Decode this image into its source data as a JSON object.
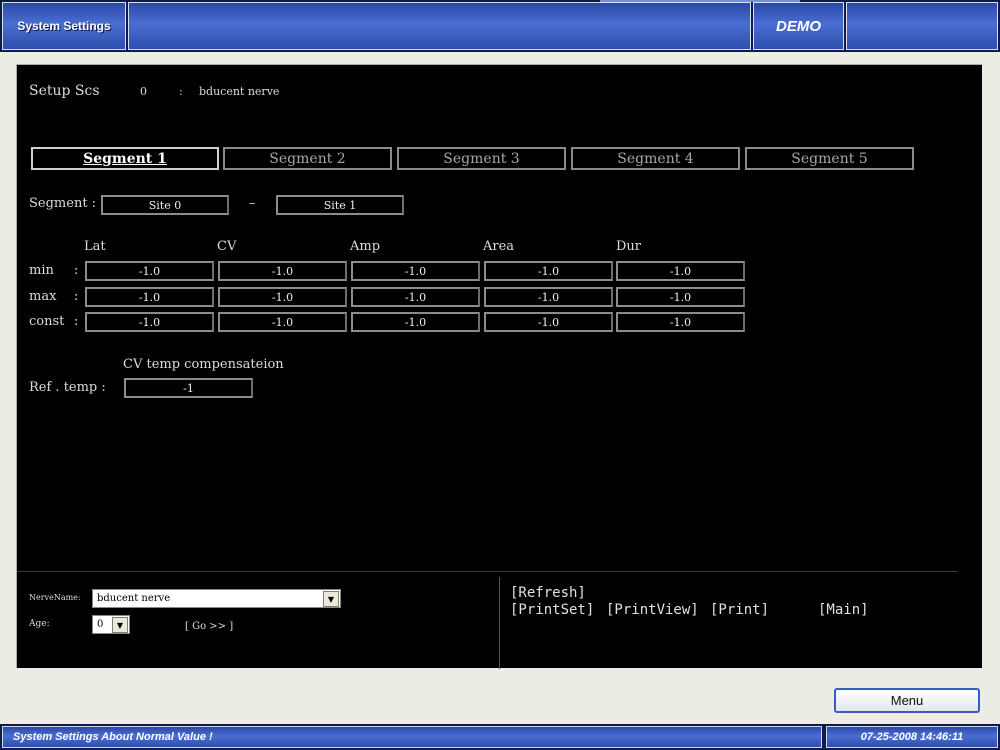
{
  "header": {
    "title": "System Settings",
    "badge": "DEMO"
  },
  "setup": {
    "label": "Setup Scs",
    "number": "0",
    "separator": ":",
    "nerve": "bducent nerve"
  },
  "segment_tabs": [
    "Segment 1",
    "Segment 2",
    "Segment 3",
    "Segment 4",
    "Segment 5"
  ],
  "segment_row": {
    "label": "Segment :",
    "site_from": "Site 0",
    "dash": "–",
    "site_to": "Site 1"
  },
  "grid": {
    "columns": [
      "Lat",
      "CV",
      "Amp",
      "Area",
      "Dur"
    ],
    "rows": [
      {
        "label": "min",
        "colon": ":",
        "values": [
          "-1.0",
          "-1.0",
          "-1.0",
          "-1.0",
          "-1.0"
        ]
      },
      {
        "label": "max",
        "colon": ":",
        "values": [
          "-1.0",
          "-1.0",
          "-1.0",
          "-1.0",
          "-1.0"
        ]
      },
      {
        "label": "const",
        "colon": ":",
        "values": [
          "-1.0",
          "-1.0",
          "-1.0",
          "-1.0",
          "-1.0"
        ]
      }
    ]
  },
  "temp": {
    "heading": "CV temp compensateion",
    "label": "Ref . temp :",
    "value": "-1"
  },
  "bottom": {
    "nerve_name_label": "NerveName:",
    "nerve_name_value": "bducent nerve",
    "age_label": "Age:",
    "age_value": "0",
    "go_label": "[ Go >> ]",
    "refresh": "[Refresh]",
    "printset": "[PrintSet]",
    "printview": "[PrintView]",
    "print": "[Print]",
    "main": "[Main]"
  },
  "menu_button": "Menu",
  "status": {
    "message": "System Settings About Normal Value !",
    "datetime": "07-25-2008  14:46:11"
  },
  "icons": {
    "dropdown": "chevron-down-icon"
  },
  "colors": {
    "titlebar": "#2f4eac",
    "screen_bg": "#000000",
    "window_bg": "#ecebe4"
  }
}
